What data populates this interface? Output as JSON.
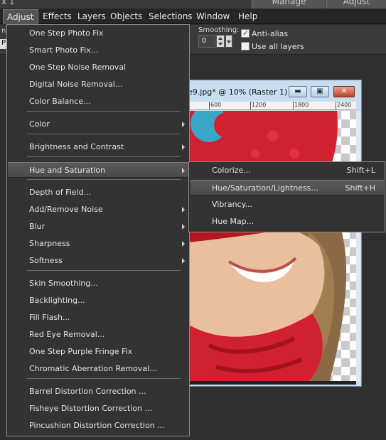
{
  "workspace": {
    "left_fragment": "x 1",
    "tabs": [
      "Manage",
      "Adjust"
    ]
  },
  "menubar": [
    "Adjust",
    "Effects",
    "Layers",
    "Objects",
    "Selections",
    "Window",
    "Help"
  ],
  "toolbar": {
    "fragment": "n t",
    "p_fragment": "P",
    "smoothing_label": "Smoothing:",
    "smoothing_value": "0",
    "antialias_label": "Anti-alias",
    "antialias_checked": true,
    "use_all_layers_label": "Use all layers",
    "use_all_layers_checked": false
  },
  "document": {
    "title": "e9.jpg* @  10% (Raster 1)",
    "ruler_ticks": [
      "600",
      "1200",
      "1800",
      "2400"
    ],
    "accent_colors": {
      "frame": "#c8ddf0",
      "close": "#c1412a",
      "hat": "#d1202f",
      "hat_pom": "#3aa6c7"
    }
  },
  "adjust_menu": {
    "items": [
      {
        "label": "One Step Photo Fix",
        "arrow": false
      },
      {
        "label": "Smart Photo Fix...",
        "arrow": false
      },
      {
        "label": "One Step Noise Removal",
        "arrow": false
      },
      {
        "label": "Digital Noise Removal...",
        "arrow": false
      },
      {
        "label": "Color Balance...",
        "arrow": false
      },
      {
        "label": "Color",
        "arrow": true
      },
      {
        "label": "Brightness and Contrast",
        "arrow": true
      },
      {
        "label": "Hue and Saturation",
        "arrow": true,
        "highlighted": true
      },
      {
        "label": "Depth of Field...",
        "arrow": false
      },
      {
        "label": "Add/Remove Noise",
        "arrow": true
      },
      {
        "label": "Blur",
        "arrow": true
      },
      {
        "label": "Sharpness",
        "arrow": true
      },
      {
        "label": "Softness",
        "arrow": true
      },
      {
        "label": "Skin Smoothing...",
        "arrow": false
      },
      {
        "label": "Backlighting...",
        "arrow": false
      },
      {
        "label": "Fill Flash...",
        "arrow": false
      },
      {
        "label": "Red Eye Removal...",
        "arrow": false
      },
      {
        "label": "One Step Purple Fringe Fix",
        "arrow": false
      },
      {
        "label": "Chromatic Aberration Removal...",
        "arrow": false
      },
      {
        "label": "Barrel Distortion Correction ...",
        "arrow": false
      },
      {
        "label": "Fisheye Distortion Correction ...",
        "arrow": false
      },
      {
        "label": "Pincushion Distortion Correction ...",
        "arrow": false
      }
    ]
  },
  "hue_submenu": {
    "items": [
      {
        "label": "Colorize...",
        "shortcut": "Shift+L"
      },
      {
        "label": "Hue/Saturation/Lightness...",
        "shortcut": "Shift+H",
        "highlighted": true
      },
      {
        "label": "Vibrancy...",
        "shortcut": ""
      },
      {
        "label": "Hue Map...",
        "shortcut": ""
      }
    ]
  }
}
